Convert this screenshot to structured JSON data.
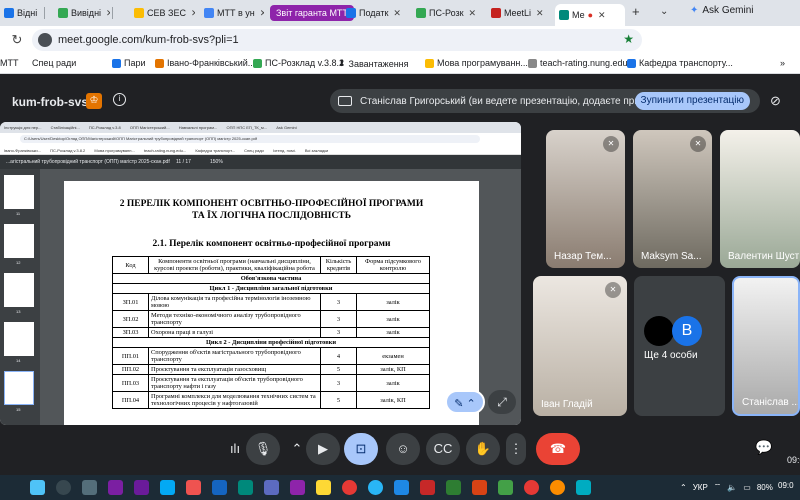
{
  "browser": {
    "tabs": [
      {
        "label": "Відні",
        "color": "#1a73e8"
      },
      {
        "label": "Вивідні",
        "color": "#34a853"
      },
      {
        "label": "СЕВ ЗЕС",
        "color": "#fbbc04"
      },
      {
        "label": "МТТ в ун",
        "color": "#4285f4"
      },
      {
        "label": "Звіт гаранта МТТ",
        "color": "#8e24aa",
        "pill": true
      },
      {
        "label": "Податк",
        "color": "#1a73e8"
      },
      {
        "label": "ПС-Розк",
        "color": "#34a853"
      },
      {
        "label": "MeetLi",
        "color": "#c5221f"
      },
      {
        "label": "Ме",
        "color": "#00897b",
        "active": true
      }
    ],
    "ask_gemini": "Ask Gemini",
    "url": "meet.google.com/kum-frob-svs?pli=1",
    "bookmarks": [
      {
        "label": "МТТ",
        "color": "#4fc3f7"
      },
      {
        "label": "Спец ради",
        "color": ""
      },
      {
        "label": "Пари",
        "color": "#1a73e8"
      },
      {
        "label": "Івано-Франківський...",
        "color": "#e37400"
      },
      {
        "label": "ПС-Розклад v.3.8.2",
        "color": "#34a853"
      },
      {
        "label": "Завантаження",
        "color": "#444"
      },
      {
        "label": "Мова програмуванн...",
        "color": "#fbbc04"
      },
      {
        "label": "teach-rating.nung.edu...",
        "color": "#888"
      },
      {
        "label": "Кафедра транспорту...",
        "color": "#1a73e8"
      }
    ]
  },
  "meet": {
    "meeting_code": "kum-frob-svs",
    "presenting_banner": "Станіслав Григорський (ви ведете презентацію, додаєте примітки)",
    "stop_presenting": "Зупинити презентацію",
    "participants": [
      {
        "name": "Назар Тем..."
      },
      {
        "name": "Maksym Sa..."
      },
      {
        "name": "Валентин Шуст"
      },
      {
        "name": "Іван Гладій"
      },
      {
        "name": "Ще 4 особи",
        "avatar_letter": "B"
      },
      {
        "name": "Станіслав ..."
      }
    ],
    "time_partial": "09:0"
  },
  "shared_screen": {
    "tabs": [
      "Інструкція для пер...",
      "Стабілізаційні...",
      "ПС-Розклад v.3.8",
      "ОПП Магістерський...",
      "Навчальні програм...",
      "ОПП НПС ЕП_ТК_м...",
      "Ask Gemini"
    ],
    "url": "C:/Users/User/Desktop/Огляд ОПП/Магістерський/ОПП Магістральний трубопровідний транспорт (ОПП) магістр 2025-скан.pdf",
    "bookmarks": [
      "Івано-Франківськи...",
      "ПС-Розклад v.3.8.2",
      "Мова програмуванн...",
      "teach-rating.nung.edu...",
      "Кафедра транспорт...",
      "Спец ради",
      "Ізтенд. помі.",
      "Всі закладки"
    ],
    "pdf_title": "...агістральний трубопровідний транспорт (ОПП) магістр 2025-скан.pdf",
    "pdf_page": "11 / 17",
    "pdf_zoom": "150%",
    "thumb_numbers": [
      "11",
      "12",
      "13",
      "14",
      "15"
    ],
    "heading_1": "2  ПЕРЕЛІК КОМПОНЕНТ ОСВІТНЬО-ПРОФЕСІЙНОЇ ПРОГРАМИ",
    "heading_1b": "ТА ЇХ ЛОГІЧНА ПОСЛІДОВНІСТЬ",
    "heading_2": "2.1. Перелік компонент освітньо-професійної програми",
    "table": {
      "headers": [
        "Код",
        "Компоненти освітньої програми (навчальні дисципліни, курсові проекти (роботи), практики, кваліфікаційна робота",
        "Кількість кредитів",
        "Форма підсумкового контролю"
      ],
      "section": "Обов'язкова частина",
      "cycle1": "Цикл 1 - Дисципліни загальної підготовки",
      "cycle2": "Цикл 2 - Дисципліни професійної підготовки",
      "rows1": [
        {
          "code": "ЗП.01",
          "name": "Ділова комунікація та професійна термінологія іноземною мовою",
          "credits": "3",
          "control": "залік"
        },
        {
          "code": "ЗП.02",
          "name": "Методи техніко-економічного аналізу трубопровідного транспорту",
          "credits": "3",
          "control": "залік"
        },
        {
          "code": "ЗП.03",
          "name": "Охорона праці в галузі",
          "credits": "3",
          "control": "залік"
        }
      ],
      "rows2": [
        {
          "code": "ПП.01",
          "name": "Спорудження об'єктів магістрального трубопровідного транспорту",
          "credits": "4",
          "control": "екзамен"
        },
        {
          "code": "ПП.02",
          "name": "Проєктування та експлуатація газосховищ",
          "credits": "5",
          "control": "залік, КП"
        },
        {
          "code": "ПП.03",
          "name": "Проєктування та експлуатація об'єктів трубопровідного транспорту нафти і газу",
          "credits": "3",
          "control": "залік"
        },
        {
          "code": "ПП.04",
          "name": "Програмні комплекси для моделювання технічних систем та технологічних процесів у нафтогазовій",
          "credits": "5",
          "control": "залік, КП"
        }
      ]
    }
  },
  "taskbar": {
    "lang": "УКР",
    "battery": "80%",
    "time": "09:0"
  }
}
